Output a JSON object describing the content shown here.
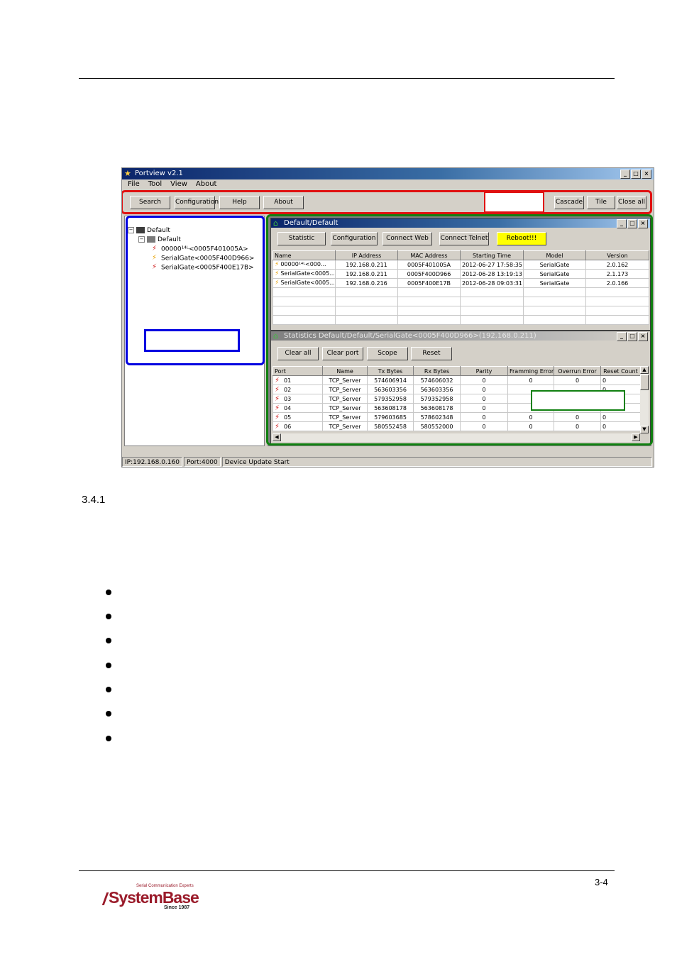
{
  "section_number": "3.4.1",
  "page_number": "3-4",
  "footer_logo": {
    "tagline": "Serial Communication Experts",
    "name": "SystemBase",
    "since": "Since 1987"
  },
  "app": {
    "title": "Portview v2.1",
    "menu": [
      "File",
      "Tool",
      "View",
      "About"
    ],
    "toolbar_left": [
      "Search",
      "Configuration",
      "Help",
      "About"
    ],
    "toolbar_right": [
      "Cascade",
      "Tile",
      "Close all"
    ],
    "tree": {
      "root": "Default",
      "group": "Default",
      "devices": [
        "00000¹⁴ᴸ<0005F401005A>",
        "SerialGate<0005F400D966>",
        "SerialGate<0005F400E17B>"
      ]
    },
    "device_window": {
      "title": "Default/Default",
      "buttons": [
        "Statistic",
        "Configuration",
        "Connect Web",
        "Connect Telnet",
        "Reboot!!!"
      ],
      "columns": [
        "Name",
        "IP Address",
        "MAC Address",
        "Starting Time",
        "Model",
        "Version"
      ],
      "rows": [
        [
          "00000¹⁴ᴸ<000...",
          "192.168.0.211",
          "0005F401005A",
          "2012-06-27 17:58:35",
          "SerialGate",
          "2.0.162"
        ],
        [
          "SerialGate<0005...",
          "192.168.0.211",
          "0005F400D966",
          "2012-06-28 13:19:13",
          "SerialGate",
          "2.1.173"
        ],
        [
          "SerialGate<0005...",
          "192.168.0.216",
          "0005F400E17B",
          "2012-06-28 09:03:31",
          "SerialGate",
          "2.0.166"
        ]
      ],
      "empty_rows": 4
    },
    "stats_window": {
      "title": "Statistics Default/Default/SerialGate<0005F400D966>(192.168.0.211)",
      "buttons": [
        "Clear all",
        "Clear port",
        "Scope",
        "Reset"
      ],
      "columns": [
        "Port",
        "Name",
        "Tx Bytes",
        "Rx Bytes",
        "Parity",
        "Framming Error",
        "Overrun Error",
        "Reset Count"
      ],
      "rows": [
        [
          "01",
          "TCP_Server",
          "574606914",
          "574606032",
          "0",
          "0",
          "0",
          "0"
        ],
        [
          "02",
          "TCP_Server",
          "563603356",
          "563603356",
          "0",
          "",
          "",
          "0"
        ],
        [
          "03",
          "TCP_Server",
          "579352958",
          "579352958",
          "0",
          "",
          "",
          "0"
        ],
        [
          "04",
          "TCP_Server",
          "563608178",
          "563608178",
          "0",
          "",
          "",
          "0"
        ],
        [
          "05",
          "TCP_Server",
          "579603685",
          "578602348",
          "0",
          "0",
          "0",
          "0"
        ],
        [
          "06",
          "TCP_Server",
          "580552458",
          "580552000",
          "0",
          "0",
          "0",
          "0"
        ]
      ]
    },
    "status": [
      "IP:192.168.0.160",
      "Port:4000",
      "Device Update Start"
    ]
  },
  "colors": {
    "toolbar_highlight": "#e01010",
    "tree_highlight": "#0000e0",
    "workspace_highlight": "#108010",
    "reboot_button": "#ffff00",
    "title_bar": "#0a246a"
  }
}
